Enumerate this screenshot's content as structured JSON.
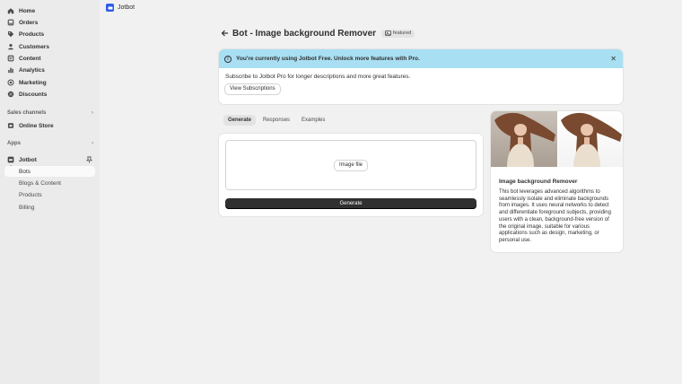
{
  "sidebar": {
    "items": [
      {
        "label": "Home",
        "icon": "home-icon"
      },
      {
        "label": "Orders",
        "icon": "orders-icon"
      },
      {
        "label": "Products",
        "icon": "tag-icon"
      },
      {
        "label": "Customers",
        "icon": "person-icon"
      },
      {
        "label": "Content",
        "icon": "content-icon"
      },
      {
        "label": "Analytics",
        "icon": "chart-bar-icon"
      },
      {
        "label": "Marketing",
        "icon": "target-icon"
      },
      {
        "label": "Discounts",
        "icon": "discount-icon"
      }
    ],
    "sales_channels": {
      "heading": "Sales channels",
      "items": [
        {
          "label": "Online Store",
          "icon": "store-icon"
        }
      ]
    },
    "apps": {
      "heading": "Apps",
      "app": {
        "label": "Jotbot",
        "icon": "jotbot-icon"
      },
      "subitems": [
        {
          "label": "Bots",
          "active": true
        },
        {
          "label": "Blogs & Content"
        },
        {
          "label": "Products"
        },
        {
          "label": "Billing"
        }
      ]
    }
  },
  "topbar": {
    "app_name": "Jotbot"
  },
  "header": {
    "title": "Bot - Image background Remover",
    "badge": "featured"
  },
  "banner": {
    "title": "You're currently using Jotbot Free. Unlock more features with Pro.",
    "body": "Subscribe to Jotbot Pro for longer descriptions and more great features.",
    "button": "View Subscriptions",
    "color": "#a9dff3"
  },
  "tabs": [
    {
      "label": "Generate",
      "active": true
    },
    {
      "label": "Responses"
    },
    {
      "label": "Examples"
    }
  ],
  "generate": {
    "file_button": "Image file",
    "submit": "Generate"
  },
  "info_card": {
    "title": "Image background Remover",
    "description": "This bot leverages advanced algorithms to seamlessly isolate and eliminate backgrounds from images. It uses neural networks to detect and differentiate foreground subjects, providing users with a clean, background-free version of the original image, suitable for various applications such as design, marketing, or personal use."
  }
}
